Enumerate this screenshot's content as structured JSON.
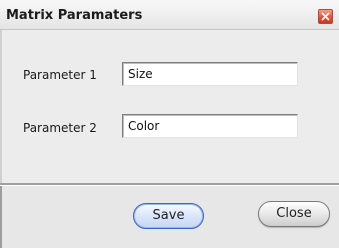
{
  "window": {
    "title": "Matrix Paramaters",
    "close_icon": "close-icon"
  },
  "form": {
    "parameter1": {
      "label": "Parameter 1",
      "value": "Size"
    },
    "parameter2": {
      "label": "Parameter 2",
      "value": "Color"
    }
  },
  "buttons": {
    "save_label": "Save",
    "close_label": "Close"
  },
  "colors": {
    "close_button": "#e0543a",
    "save_button_border": "#3d64c8"
  }
}
